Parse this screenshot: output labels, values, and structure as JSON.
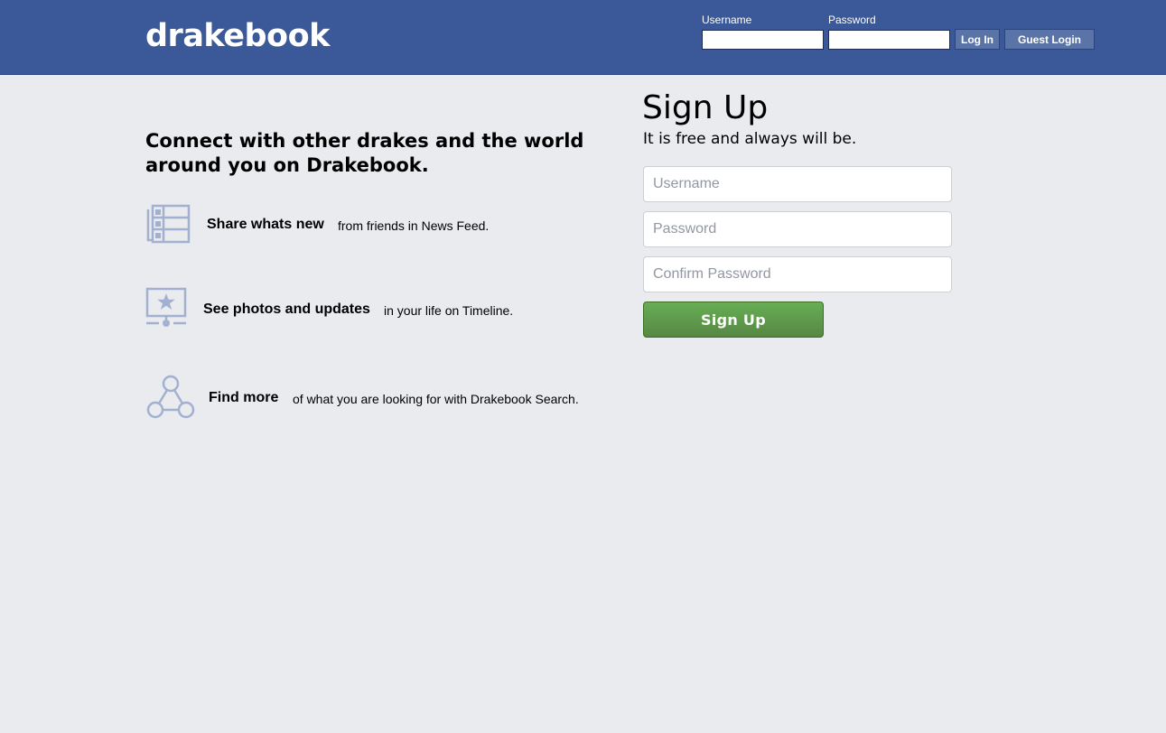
{
  "header": {
    "logo": "drakebook",
    "login": {
      "username_label": "Username",
      "password_label": "Password",
      "login_button": "Log In",
      "guest_button": "Guest Login",
      "username_value": "",
      "password_value": ""
    }
  },
  "intro": {
    "headline": "Connect with other drakes and the world around you on Drakebook."
  },
  "features": [
    {
      "icon": "news-feed-icon",
      "title": "Share whats new",
      "description": "from friends in News Feed."
    },
    {
      "icon": "timeline-photo-icon",
      "title": "See photos and updates",
      "description": "in your life on Timeline."
    },
    {
      "icon": "search-graph-icon",
      "title": "Find more",
      "description": "of what you are looking for with Drakebook Search."
    }
  ],
  "signup": {
    "title": "Sign Up",
    "subtitle": "It is free and always will be.",
    "username_placeholder": "Username",
    "password_placeholder": "Password",
    "confirm_placeholder": "Confirm Password",
    "button": "Sign Up"
  },
  "colors": {
    "header": "#3b5998",
    "background": "#e9ebee",
    "icon": "#a3b1d1",
    "signup_button": "#5f9c4a"
  }
}
